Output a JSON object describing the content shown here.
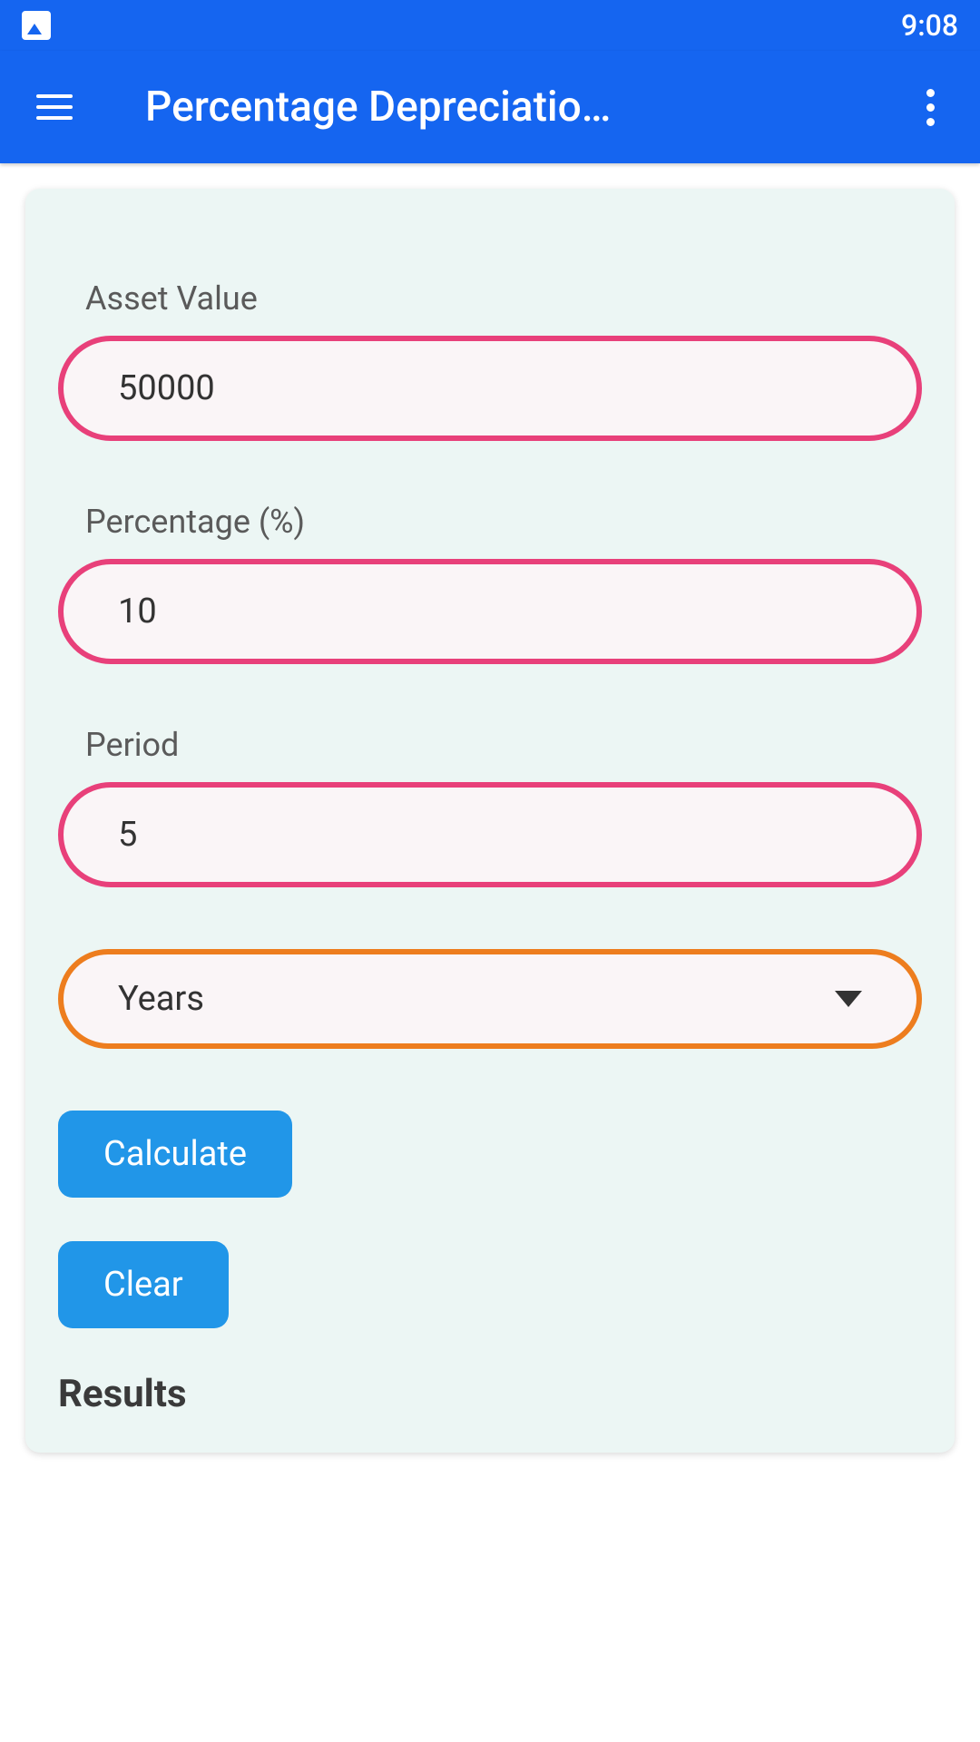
{
  "statusBar": {
    "time": "9:08"
  },
  "appBar": {
    "title": "Percentage Depreciatio…"
  },
  "form": {
    "assetValue": {
      "label": "Asset Value",
      "value": "50000"
    },
    "percentage": {
      "label": "Percentage (%)",
      "value": "10"
    },
    "period": {
      "label": "Period",
      "value": "5"
    },
    "unit": {
      "selected": "Years"
    },
    "calculateButton": "Calculate",
    "clearButton": "Clear"
  },
  "results": {
    "heading": "Results"
  }
}
